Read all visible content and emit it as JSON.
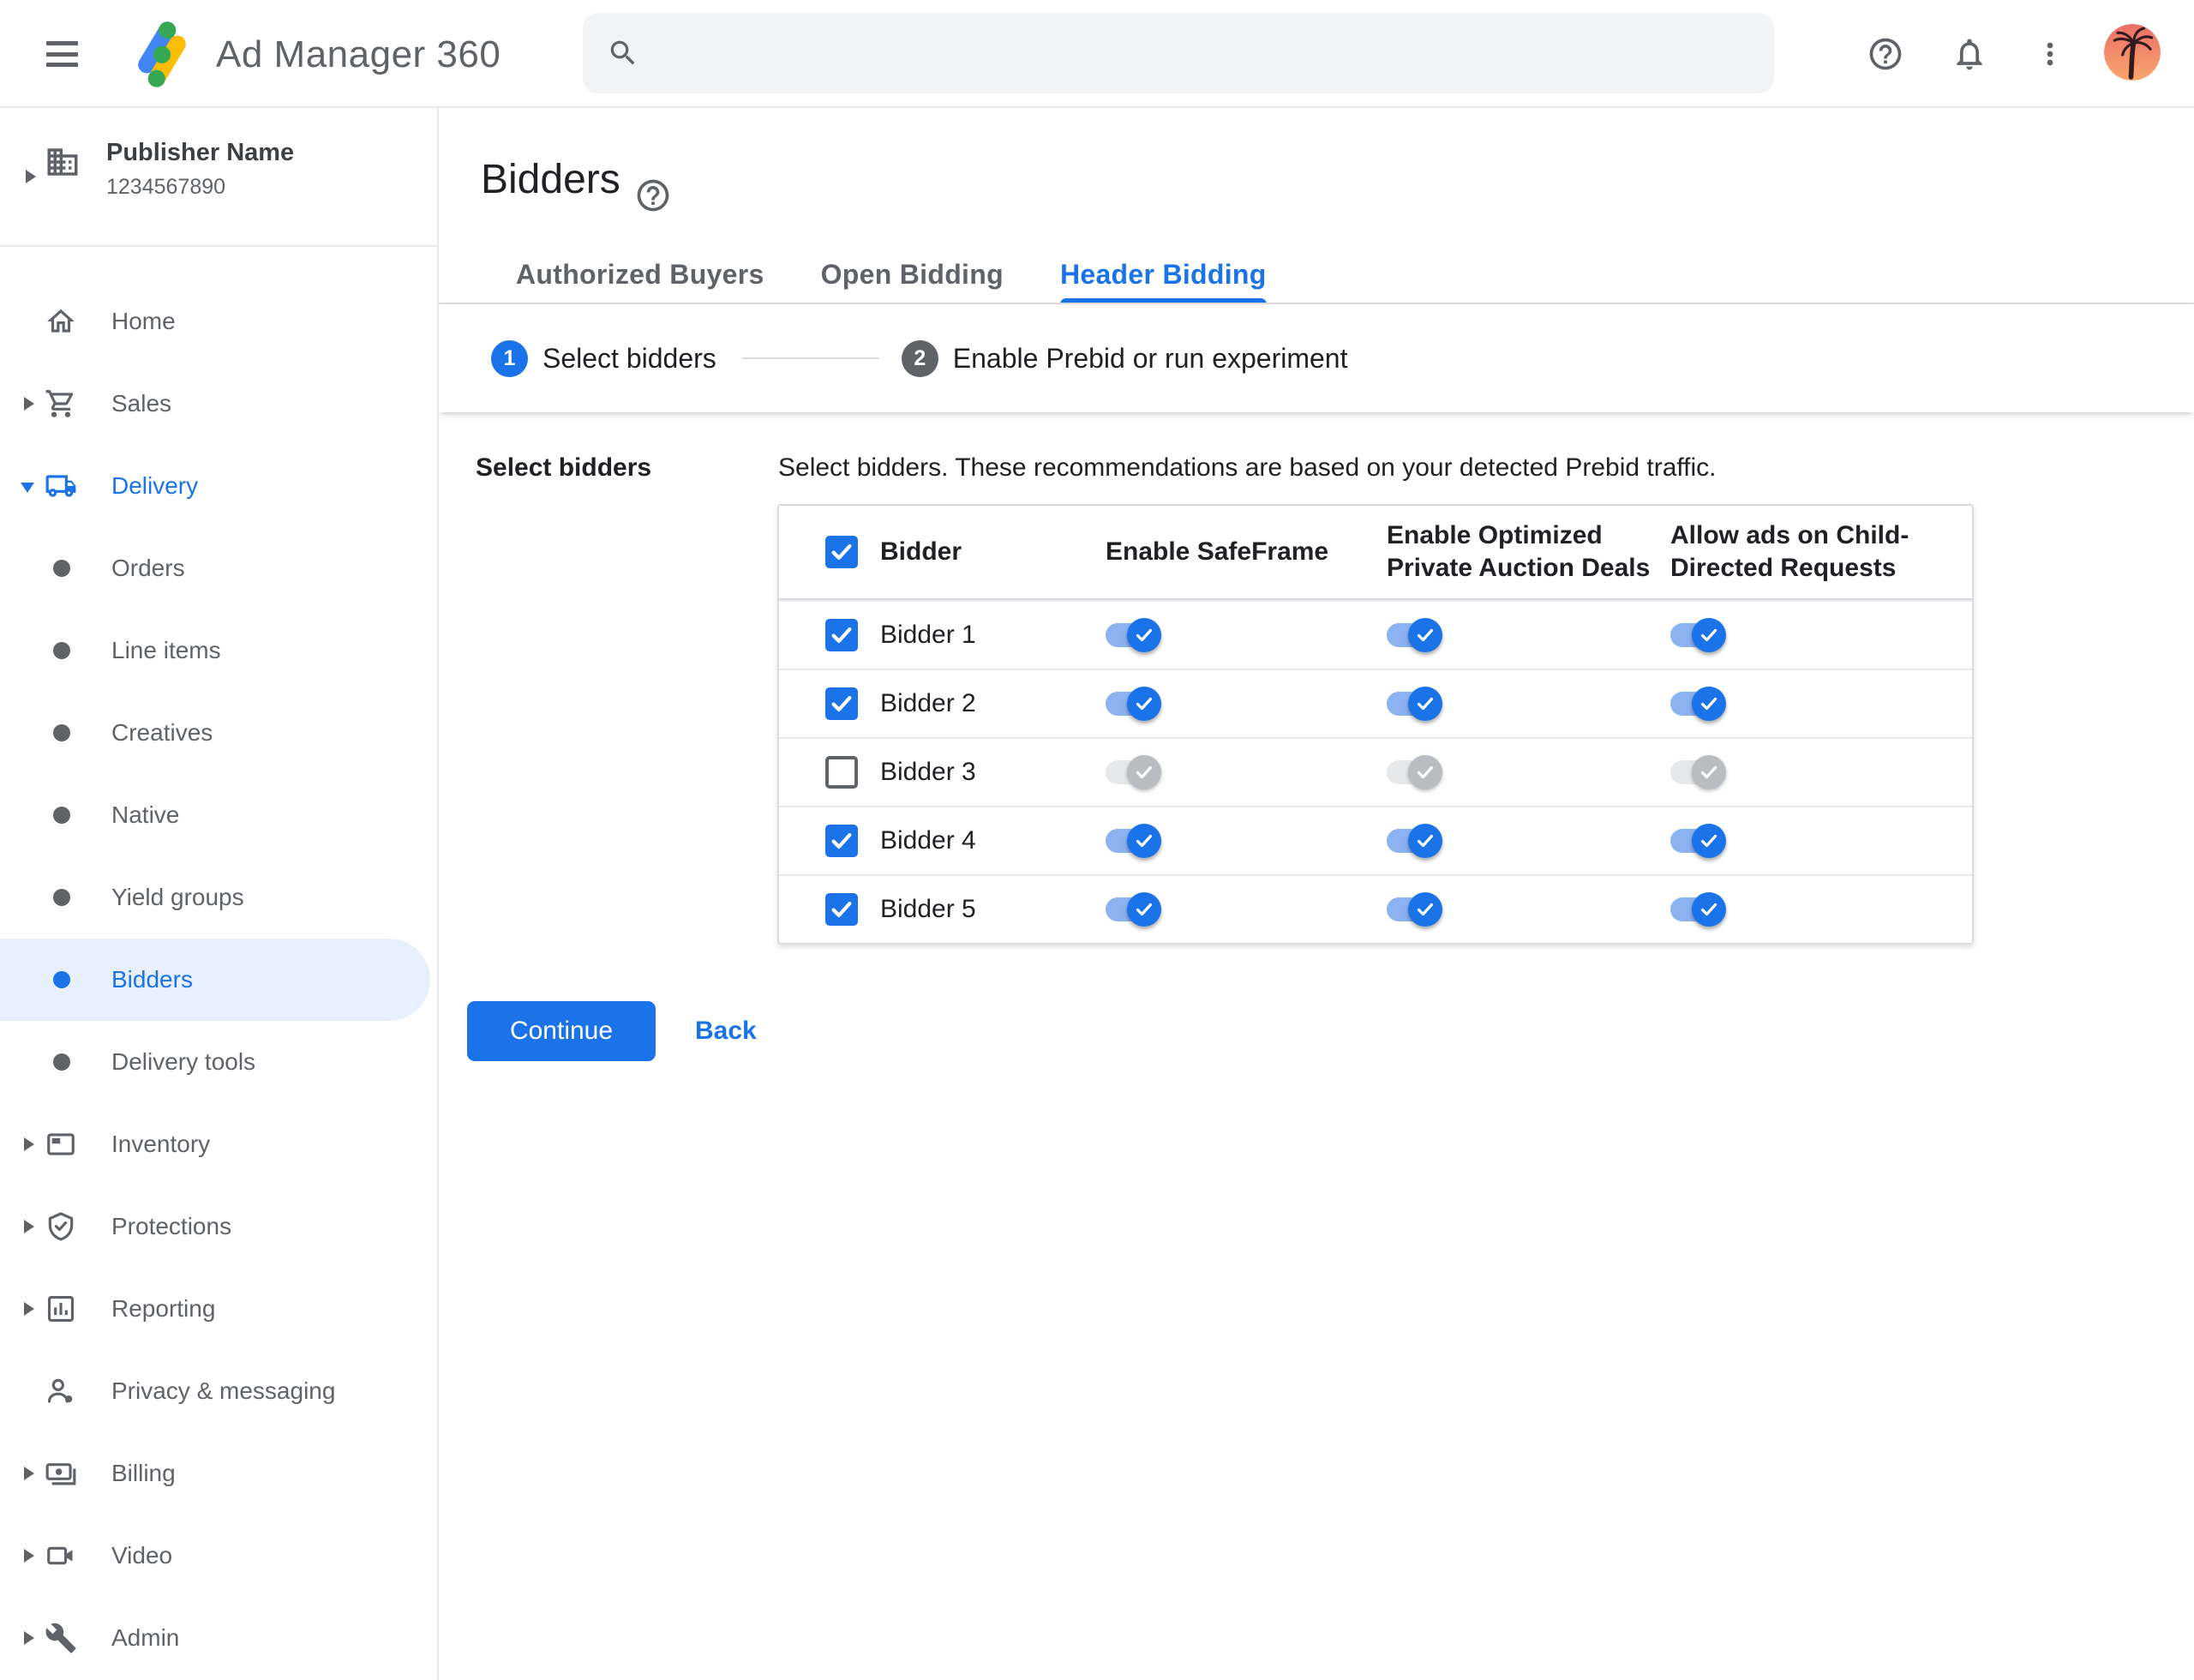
{
  "colors": {
    "accent": "#1a73e8",
    "selected_bg": "#e8f0fe",
    "toggle_on_track": "#8cb2f2",
    "toggle_off_track": "#e6e8ea",
    "toggle_off_thumb": "#b9bdc2",
    "logo_blue": "#4285f4",
    "logo_yellow": "#fbbc04",
    "logo_green": "#34a853"
  },
  "header": {
    "app_title": "Ad Manager 360",
    "search_placeholder": "",
    "search_value": ""
  },
  "sidebar": {
    "publisher": {
      "name": "Publisher Name",
      "id": "1234567890"
    },
    "items": [
      {
        "label": "Home",
        "icon": "home",
        "arrow": "none",
        "type": "item"
      },
      {
        "label": "Sales",
        "icon": "cart",
        "arrow": "right",
        "type": "item"
      },
      {
        "label": "Delivery",
        "icon": "truck",
        "arrow": "down",
        "type": "item",
        "active": true
      },
      {
        "label": "Orders",
        "icon": "bullet",
        "arrow": "none",
        "type": "sub"
      },
      {
        "label": "Line items",
        "icon": "bullet",
        "arrow": "none",
        "type": "sub"
      },
      {
        "label": "Creatives",
        "icon": "bullet",
        "arrow": "none",
        "type": "sub"
      },
      {
        "label": "Native",
        "icon": "bullet",
        "arrow": "none",
        "type": "sub"
      },
      {
        "label": "Yield groups",
        "icon": "bullet",
        "arrow": "none",
        "type": "sub"
      },
      {
        "label": "Bidders",
        "icon": "bullet",
        "arrow": "none",
        "type": "sub",
        "selected": true
      },
      {
        "label": "Delivery tools",
        "icon": "bullet",
        "arrow": "none",
        "type": "sub"
      },
      {
        "label": "Inventory",
        "icon": "inventory",
        "arrow": "right",
        "type": "item"
      },
      {
        "label": "Protections",
        "icon": "shield",
        "arrow": "right",
        "type": "item"
      },
      {
        "label": "Reporting",
        "icon": "report",
        "arrow": "right",
        "type": "item"
      },
      {
        "label": "Privacy & messaging",
        "icon": "privacy",
        "arrow": "none",
        "type": "item"
      },
      {
        "label": "Billing",
        "icon": "payments",
        "arrow": "right",
        "type": "item"
      },
      {
        "label": "Video",
        "icon": "videocam",
        "arrow": "right",
        "type": "item"
      },
      {
        "label": "Admin",
        "icon": "wrench",
        "arrow": "right",
        "type": "item"
      }
    ]
  },
  "main": {
    "page_title": "Bidders",
    "tabs": [
      {
        "label": "Authorized Buyers",
        "active": false
      },
      {
        "label": "Open Bidding",
        "active": false
      },
      {
        "label": "Header Bidding",
        "active": true
      }
    ],
    "stepper": [
      {
        "number": "1",
        "label": "Select bidders",
        "state": "active"
      },
      {
        "number": "2",
        "label": "Enable Prebid or run experiment",
        "state": "upcoming"
      }
    ],
    "section_label": "Select bidders",
    "description": "Select bidders. These recommendations are based on your detected Prebid traffic.",
    "table": {
      "header_checkbox_checked": true,
      "columns": [
        "Bidder",
        "Enable SafeFrame",
        "Enable Optimized\nPrivate Auction Deals",
        "Allow ads on Child-\nDirected Requests"
      ],
      "rows": [
        {
          "name": "Bidder 1",
          "checked": true,
          "safeframe": true,
          "optimized_private_auction": true,
          "child_directed": true
        },
        {
          "name": "Bidder 2",
          "checked": true,
          "safeframe": true,
          "optimized_private_auction": true,
          "child_directed": true
        },
        {
          "name": "Bidder 3",
          "checked": false,
          "safeframe": false,
          "optimized_private_auction": false,
          "child_directed": false
        },
        {
          "name": "Bidder 4",
          "checked": true,
          "safeframe": true,
          "optimized_private_auction": true,
          "child_directed": true
        },
        {
          "name": "Bidder 5",
          "checked": true,
          "safeframe": true,
          "optimized_private_auction": true,
          "child_directed": true
        }
      ]
    },
    "continue_label": "Continue",
    "back_label": "Back"
  }
}
